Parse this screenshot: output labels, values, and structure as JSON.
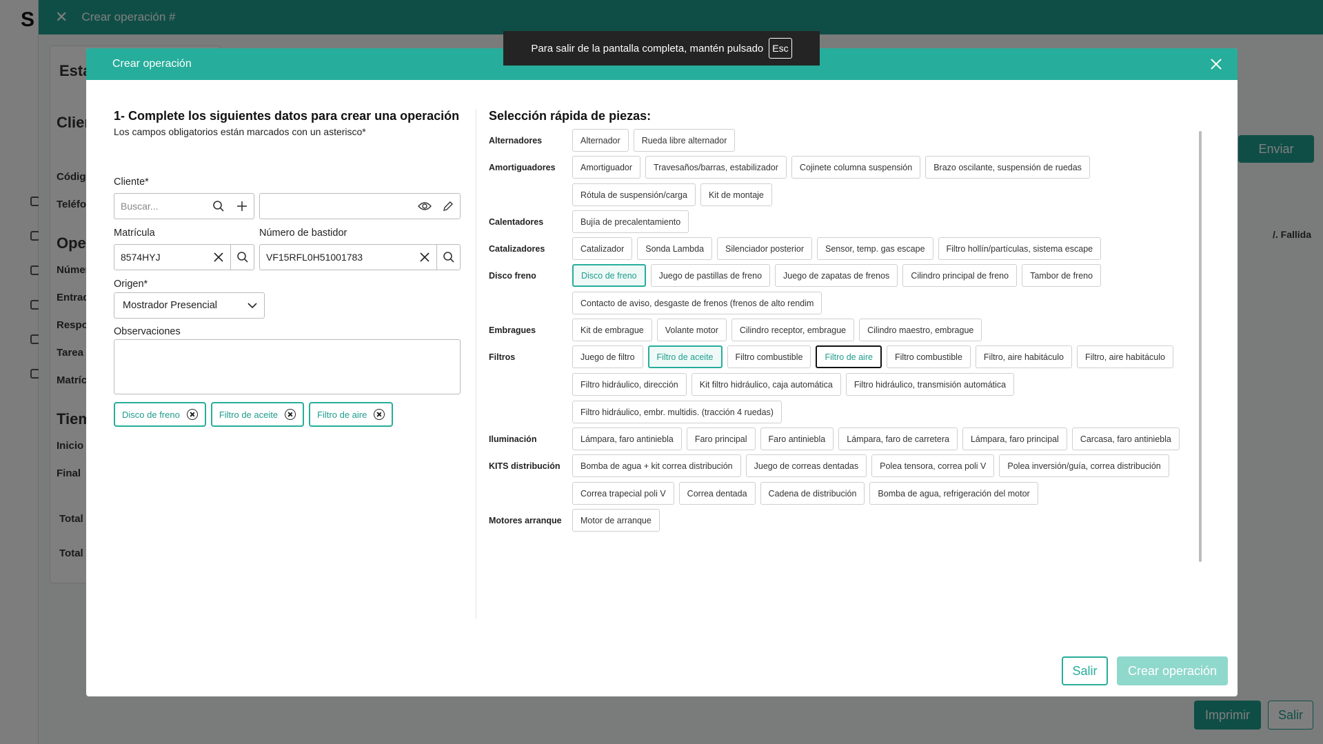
{
  "background": {
    "window_title": "Crear operación #",
    "partial_labels": [
      "Esta",
      "Clien",
      "Código",
      "Teléfo",
      "Oper",
      "Númer",
      "Entrad",
      "Respo",
      "Tarea",
      "Matríc",
      "Tiem",
      "Inicio",
      "Final",
      "Total",
      "Total"
    ],
    "send_button": "Enviar",
    "status_text": "/. Fallida",
    "print_button": "Imprimir",
    "exit_button": "Salir"
  },
  "toast": {
    "message": "Para salir de la pantalla completa, mantén pulsado",
    "key": "Esc"
  },
  "modal": {
    "title": "Crear operación",
    "colors": {
      "accent": "#26ad9b",
      "accent_light": "#8fd8cc"
    },
    "form": {
      "heading": "1- Complete los siguientes datos para crear una operación",
      "subheading": "Los campos obligatorios están marcados con un asterisco*",
      "client_label": "Cliente*",
      "client_placeholder": "Buscar...",
      "client_value": "",
      "plate_label": "Matrícula",
      "plate_value": "8574HYJ",
      "vin_label": "Número de bastidor",
      "vin_value": "VF15RFL0H51001783",
      "origin_label": "Origen*",
      "origin_value": "Mostrador Presencial",
      "notes_label": "Observaciones",
      "notes_value": "",
      "selected_chips": [
        "Disco de freno",
        "Filtro de aceite",
        "Filtro de aire"
      ]
    },
    "quick_select": {
      "title": "Selección rápida de piezas:",
      "categories": [
        {
          "name": "Alternadores",
          "parts": [
            "Alternador",
            "Rueda libre alternador"
          ]
        },
        {
          "name": "Amortiguadores",
          "parts": [
            "Amortiguador",
            "Travesaños/barras, estabilizador",
            "Cojinete columna suspensión",
            "Brazo oscilante, suspensión de ruedas",
            "Rótula de suspensión/carga",
            "Kit de montaje"
          ]
        },
        {
          "name": "Calentadores",
          "parts": [
            "Bujía de precalentamiento"
          ]
        },
        {
          "name": "Catalizadores",
          "parts": [
            "Catalizador",
            "Sonda Lambda",
            "Silenciador posterior",
            "Sensor, temp. gas escape",
            "Filtro hollín/partículas, sistema escape"
          ]
        },
        {
          "name": "Disco freno",
          "parts": [
            "Disco de freno",
            "Juego de pastillas de freno",
            "Juego de zapatas de frenos",
            "Cilindro principal de freno",
            "Tambor de freno",
            "Contacto de aviso, desgaste de frenos (frenos de alto rendim"
          ]
        },
        {
          "name": "Embragues",
          "parts": [
            "Kit de embrague",
            "Volante motor",
            "Cilindro receptor, embrague",
            "Cilindro maestro, embrague"
          ]
        },
        {
          "name": "Filtros",
          "parts": [
            "Juego de filtro",
            "Filtro de aceite",
            "Filtro combustible",
            "Filtro de aire",
            "Filtro combustible",
            "Filtro, aire habitáculo",
            "Filtro, aire habitáculo",
            "Filtro hidráulico, dirección",
            "Kit filtro hidráulico, caja automática",
            "Filtro hidráulico, transmisión automática",
            "Filtro hidráulico, embr. multidis. (tracción 4 ruedas)"
          ]
        },
        {
          "name": "Iluminación",
          "parts": [
            "Lámpara, faro antiniebla",
            "Faro principal",
            "Faro antiniebla",
            "Lámpara, faro de carretera",
            "Lámpara, faro principal",
            "Carcasa, faro antiniebla"
          ]
        },
        {
          "name": "KITS distribución",
          "parts": [
            "Bomba de agua + kit correa distribución",
            "Juego de correas dentadas",
            "Polea tensora, correa poli V",
            "Polea inversión/guía, correa distribución",
            "Correa trapecial poli V",
            "Correa dentada",
            "Cadena de distribución",
            "Bomba de agua, refrigeración del motor"
          ]
        },
        {
          "name": "Motores arranque",
          "parts": [
            "Motor de arranque"
          ]
        }
      ],
      "selected": [
        "Disco de freno",
        "Filtro de aceite",
        "Filtro de aire"
      ],
      "focused": "Filtro de aire"
    },
    "buttons": {
      "exit": "Salir",
      "create": "Crear operación"
    }
  }
}
